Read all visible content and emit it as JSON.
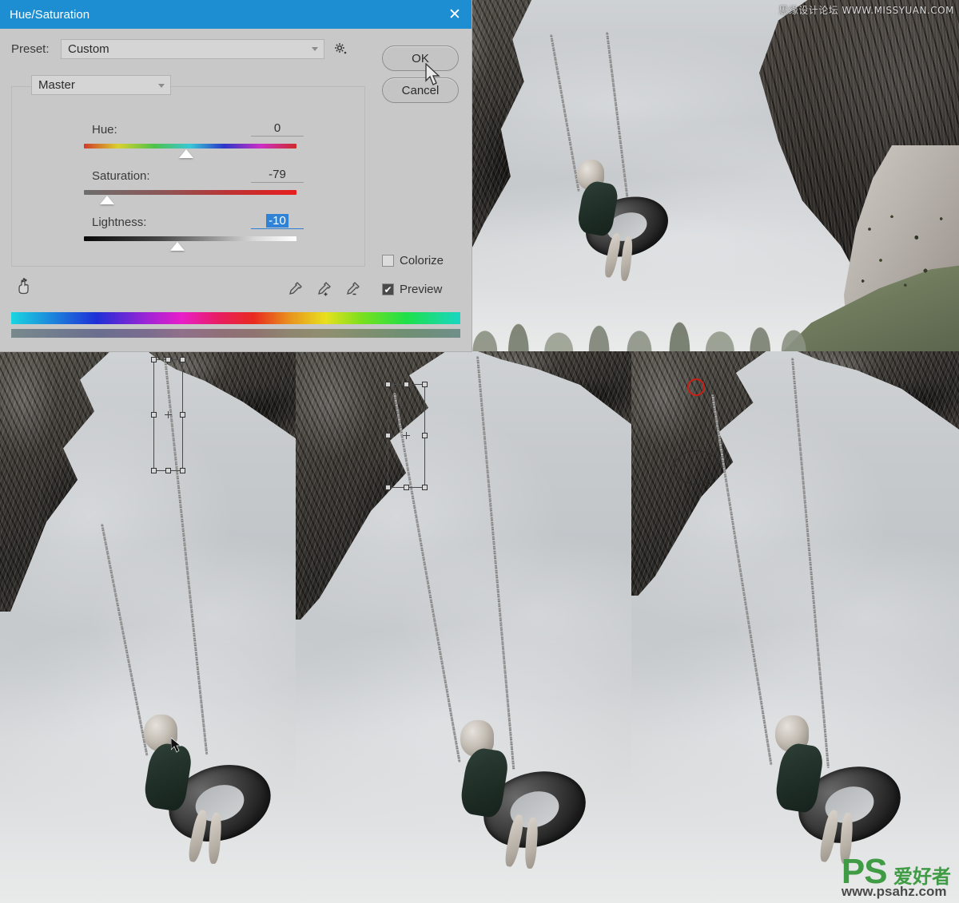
{
  "dialog": {
    "title": "Hue/Saturation",
    "close_icon": "close-icon",
    "preset": {
      "label": "Preset:",
      "value": "Custom",
      "gear_icon": "gear-icon"
    },
    "buttons": {
      "ok": "OK",
      "cancel": "Cancel"
    },
    "channel": {
      "value": "Master"
    },
    "sliders": [
      {
        "name": "Hue:",
        "value": "0",
        "thumb_pct": 48,
        "focused": false,
        "track": "hue"
      },
      {
        "name": "Saturation:",
        "value": "-79",
        "thumb_pct": 11,
        "focused": false,
        "track": "sat"
      },
      {
        "name": "Lightness:",
        "value": "-10",
        "thumb_pct": 44,
        "focused": true,
        "track": "light"
      }
    ],
    "checkboxes": [
      {
        "label": "Colorize",
        "checked": false,
        "mark": ""
      },
      {
        "label": "Preview",
        "checked": true,
        "mark": "✔"
      }
    ],
    "tools": {
      "hand_icon": "on-image-adjust-hand-icon",
      "eyedropper_icon": "eyedropper-icon",
      "eyedropper_add_icon": "eyedropper-add-icon",
      "eyedropper_subtract_icon": "eyedropper-subtract-icon"
    },
    "colors": {
      "titlebar": "#1d8ed1",
      "dialog_bg": "#c8c8c8",
      "selection_blue": "#2f82d6",
      "sample_ring_red": "#cc1f14"
    }
  },
  "watermarks": {
    "top_right": "思缘设计论坛 WWW.MISSYUAN.COM",
    "bottom_right_brand": "PS",
    "bottom_right_cn": "爱好者",
    "bottom_right_url": "www.psahz.com"
  },
  "panels": [
    {
      "name": "panel-top-right",
      "note": "girl on tire swing under inverted cliff / hair silhouette"
    },
    {
      "name": "panel-bottom-left",
      "note": "transform selection box on chain, arrow cursor"
    },
    {
      "name": "panel-bottom-middle",
      "note": "transform selection box on chain, resized"
    },
    {
      "name": "panel-bottom-right",
      "note": "brush circle cursor and red sample ring on rock"
    }
  ]
}
